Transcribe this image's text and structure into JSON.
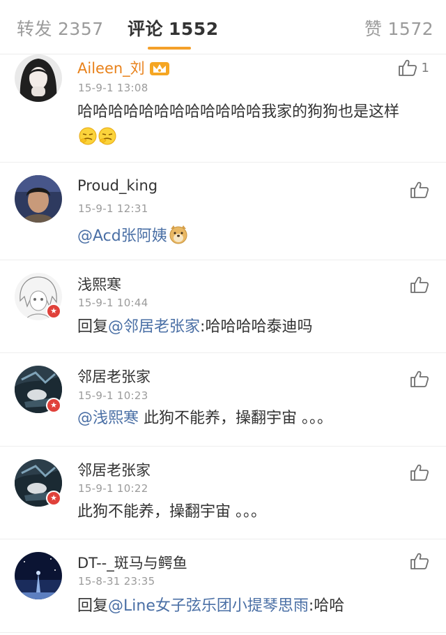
{
  "tabs": [
    {
      "label": "转发",
      "count": "2357"
    },
    {
      "label": "评论",
      "count": "1552"
    },
    {
      "label": "赞",
      "count": "1572"
    }
  ],
  "colors": {
    "accent": "#f4a02a",
    "mention": "#4a6fa5",
    "vip_name": "#e8811a",
    "badge": "#e0413a"
  },
  "comments": [
    {
      "username": "Aileen_刘",
      "time": "15-9-1 13:08",
      "text": "哈哈哈哈哈哈哈哈哈哈哈哈我家的狗狗也是这样",
      "likes": "1",
      "badges": [
        "crown-icon"
      ],
      "emoji": "smirk-emoji"
    },
    {
      "username": "Proud_king",
      "time": "15-9-1 12:31",
      "mention": "@Acd张阿姨",
      "emoji": "doge-emoji"
    },
    {
      "username": "浅熙寒",
      "time": "15-9-1 10:44",
      "prefix": "回复",
      "mention": "@邻居老张家",
      "text": ":哈哈哈哈泰迪吗"
    },
    {
      "username": "邻居老张家",
      "time": "15-9-1 10:23",
      "mention": "@浅熙寒",
      "text": " 此狗不能养，操翻宇宙 。。。"
    },
    {
      "username": "邻居老张家",
      "time": "15-9-1 10:22",
      "text": "此狗不能养，操翻宇宙 。。。"
    },
    {
      "username": "DT--_斑马与鳄鱼",
      "time": "15-8-31 23:35",
      "prefix": "回复",
      "mention": "@Line女子弦乐团小提琴思雨",
      "text": ":哈哈"
    }
  ]
}
